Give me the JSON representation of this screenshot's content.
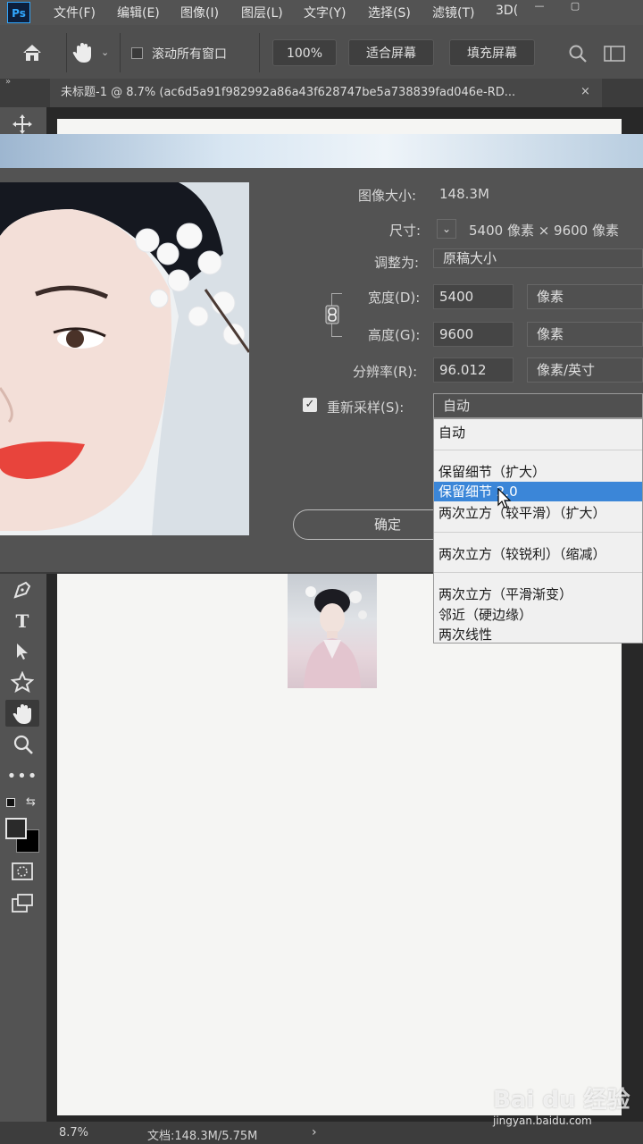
{
  "app": {
    "logo": "Ps"
  },
  "menu": [
    "文件(F)",
    "编辑(E)",
    "图像(I)",
    "图层(L)",
    "文字(Y)",
    "选择(S)",
    "滤镜(T)",
    "3D("
  ],
  "options": {
    "scroll_all_label": "滚动所有窗口",
    "zoom_value": "100%",
    "fit_screen": "适合屏幕",
    "fill_screen": "填充屏幕"
  },
  "tab": {
    "title": "未标题-1 @ 8.7% (ac6d5a91f982992a86a43f628747be5a738839fad046e-RD..."
  },
  "dialog": {
    "image_size_label": "图像大小:",
    "image_size_value": "148.3M",
    "dimensions_label": "尺寸:",
    "dimensions_value": "5400 像素 × 9600 像素",
    "fit_to_label": "调整为:",
    "fit_to_value": "原稿大小",
    "width_label": "宽度(D):",
    "width_value": "5400",
    "width_unit": "像素",
    "height_label": "高度(G):",
    "height_value": "9600",
    "height_unit": "像素",
    "resolution_label": "分辨率(R):",
    "resolution_value": "96.012",
    "resolution_unit": "像素/英寸",
    "resample_label": "重新采样(S):",
    "resample_value": "自动",
    "ok_label": "确定"
  },
  "resample_options": {
    "auto": "自动",
    "preserve_enlarge": "保留细节（扩大）",
    "preserve_2": "保留细节 2.0",
    "bicubic_smoother": "两次立方（较平滑）（扩大）",
    "bicubic_sharper": "两次立方（较锐利）（缩减）",
    "bicubic_smooth": "两次立方（平滑渐变）",
    "nearest": "邻近（硬边缘）",
    "bilinear": "两次线性"
  },
  "status": {
    "zoom": "8.7%",
    "doc": "文档:148.3M/5.75M"
  },
  "watermark": {
    "text": "Bai du 经验",
    "url": "jingyan.baidu.com"
  }
}
